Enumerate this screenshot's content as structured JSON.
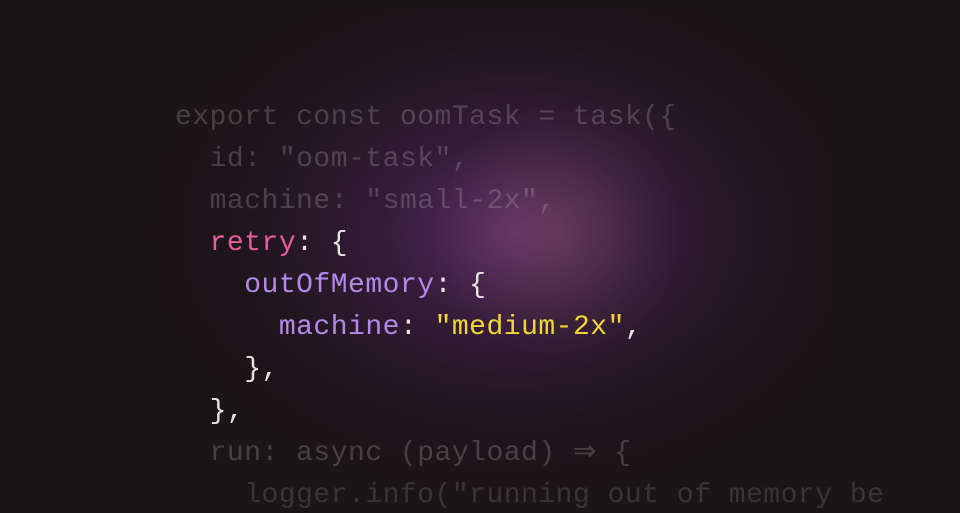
{
  "code": {
    "line1_a": "export const oomTask = task({",
    "line2_a": "  id: ",
    "line2_b": "\"oom-task\"",
    "line2_c": ",",
    "line3_a": "  machine: ",
    "line3_b": "\"small-2x\"",
    "line3_c": ",",
    "line4_a": "  ",
    "line4_retry": "retry",
    "line4_b": ": {",
    "line5_a": "    ",
    "line5_oom": "outOfMemory",
    "line5_b": ": {",
    "line6_a": "      ",
    "line6_machine": "machine",
    "line6_b": ": ",
    "line6_string": "\"medium-2x\"",
    "line6_c": ",",
    "line7": "    },",
    "line8": "  },",
    "line9_a": "  run: async (payload) ",
    "line9_arrow": "⇒",
    "line9_b": " {",
    "line10_a": "    logger.info(",
    "line10_b": "\"running out of memory be"
  }
}
